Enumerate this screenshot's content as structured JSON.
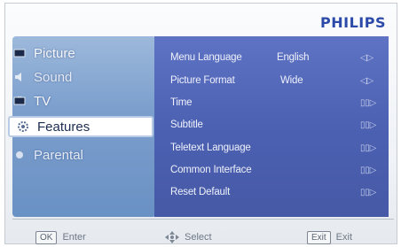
{
  "brand": "PHILIPS",
  "menu": {
    "items": [
      {
        "label": "Picture",
        "icon": "monitor-icon"
      },
      {
        "label": "Sound",
        "icon": "speaker-icon"
      },
      {
        "label": "TV",
        "icon": "tv-icon"
      },
      {
        "label": "Features",
        "icon": "gear-icon",
        "selected": true
      },
      {
        "label": "Parental",
        "icon": "lock-icon"
      }
    ]
  },
  "settings": [
    {
      "label": "Menu Language",
      "value": "English",
      "control": "◁▷"
    },
    {
      "label": "Picture Format",
      "value": "Wide",
      "control": "◁▷"
    },
    {
      "label": "Time",
      "value": "",
      "control": "▯▯▷"
    },
    {
      "label": "Subtitle",
      "value": "",
      "control": "▯▯▷"
    },
    {
      "label": "Teletext Language",
      "value": "",
      "control": "▯▯▷"
    },
    {
      "label": "Common Interface",
      "value": "",
      "control": "▯▯▷"
    },
    {
      "label": "Reset Default",
      "value": "",
      "control": "▯▯▷"
    }
  ],
  "footer": {
    "enter_key": "OK",
    "enter_label": "Enter",
    "select_label": "Select",
    "exit_key": "Exit",
    "exit_label": "Exit"
  },
  "colors": {
    "brand": "#2c4aa7",
    "left_panel": "#7c9fcd",
    "right_panel": "#4d61b3",
    "selected_bg": "#ffffff"
  }
}
